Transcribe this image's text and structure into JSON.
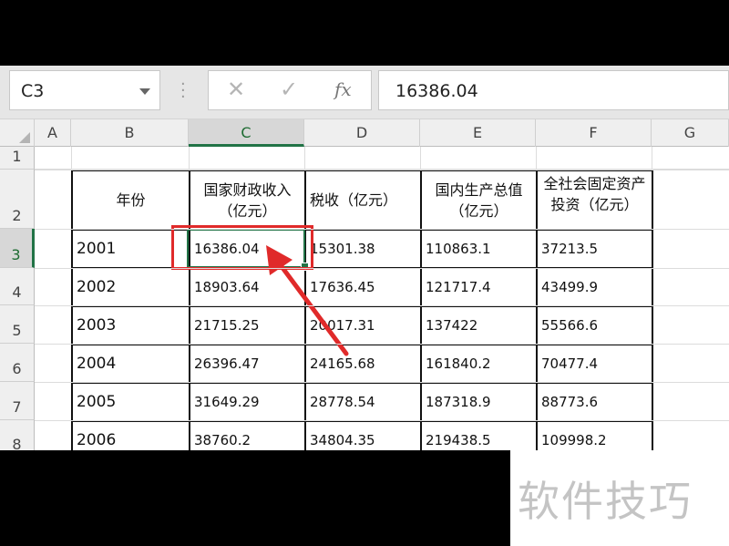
{
  "name_box": {
    "value": "C3"
  },
  "formula_bar": {
    "cancel_icon": "✕",
    "enter_icon": "✓",
    "fx_label": "fx",
    "value": "16386.04"
  },
  "columns": [
    "A",
    "B",
    "C",
    "D",
    "E",
    "F",
    "G"
  ],
  "selected_column": "C",
  "rows": [
    "1",
    "2",
    "3",
    "4",
    "5",
    "6",
    "7",
    "8"
  ],
  "selected_row": "3",
  "table": {
    "headers": [
      "年份",
      "国家财政收入（亿元）",
      "税收（亿元）",
      "国内生产总值（亿元）",
      "全社会固定资产投资（亿元）"
    ],
    "rows": [
      [
        "2001",
        "16386.04",
        "15301.38",
        "110863.1",
        "37213.5"
      ],
      [
        "2002",
        "18903.64",
        "17636.45",
        "121717.4",
        "43499.9"
      ],
      [
        "2003",
        "21715.25",
        "20017.31",
        "137422",
        "55566.6"
      ],
      [
        "2004",
        "26396.47",
        "24165.68",
        "161840.2",
        "70477.4"
      ],
      [
        "2005",
        "31649.29",
        "28778.54",
        "187318.9",
        "88773.6"
      ],
      [
        "2006",
        "38760.2",
        "34804.35",
        "219438.5",
        "109998.2"
      ]
    ]
  },
  "annotation": {
    "highlight_color": "#e02a2a",
    "accent_color": "#217346"
  },
  "watermark": {
    "text": "软件技巧"
  }
}
